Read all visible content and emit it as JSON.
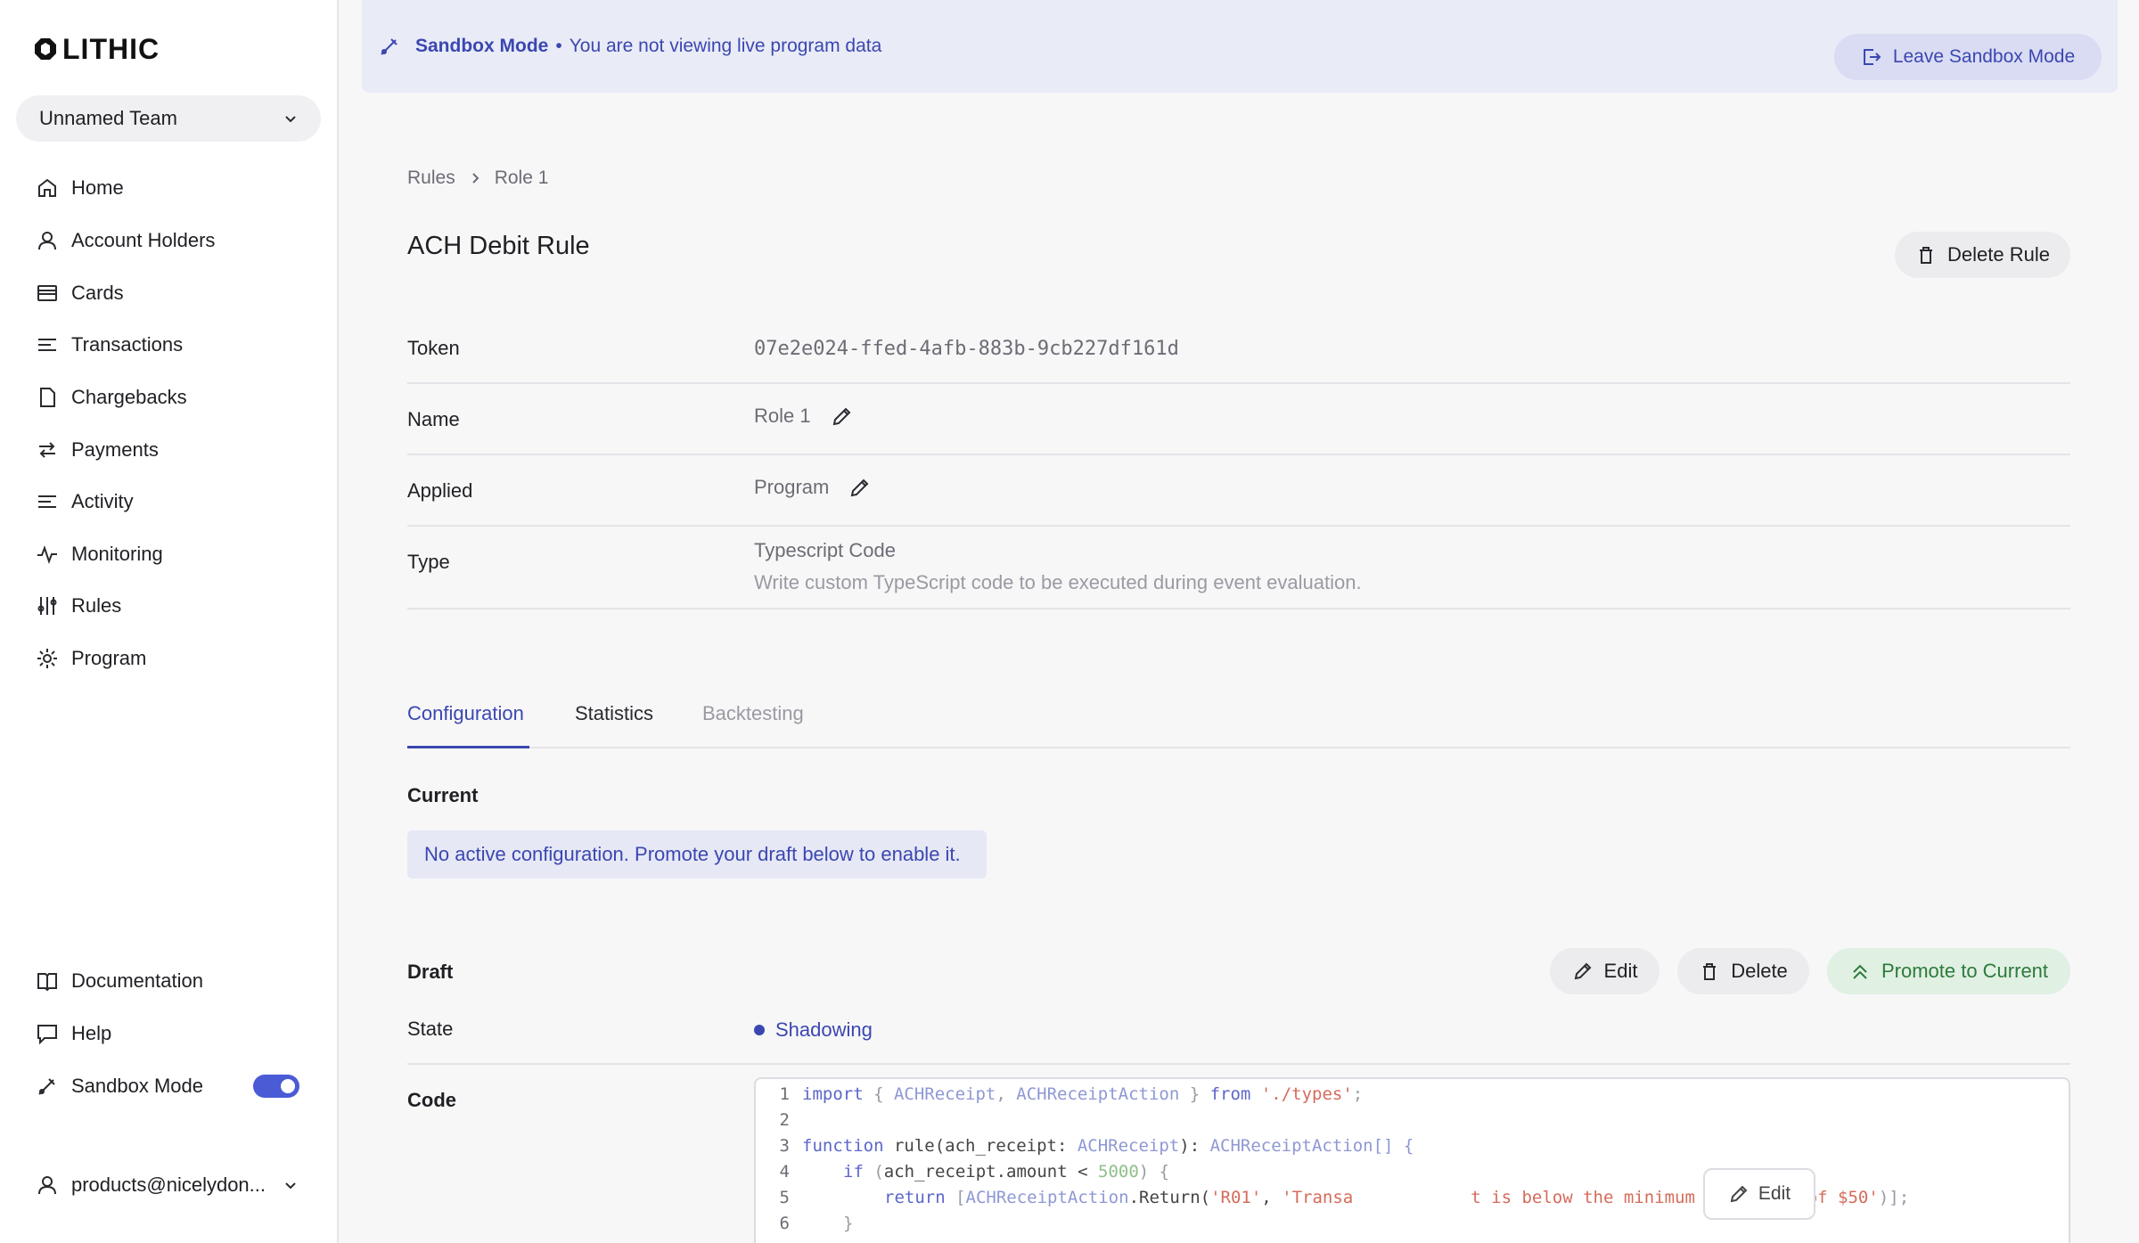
{
  "app": {
    "brand": "LITHIC"
  },
  "sidebar": {
    "team": "Unnamed Team",
    "items": [
      {
        "label": "Home",
        "icon": "home-icon"
      },
      {
        "label": "Account Holders",
        "icon": "user-icon"
      },
      {
        "label": "Cards",
        "icon": "card-icon"
      },
      {
        "label": "Transactions",
        "icon": "list-icon"
      },
      {
        "label": "Chargebacks",
        "icon": "file-icon"
      },
      {
        "label": "Payments",
        "icon": "arrows-icon"
      },
      {
        "label": "Activity",
        "icon": "list-icon"
      },
      {
        "label": "Monitoring",
        "icon": "pulse-icon"
      },
      {
        "label": "Rules",
        "icon": "sliders-icon"
      },
      {
        "label": "Program",
        "icon": "gear-icon"
      }
    ],
    "bottom": {
      "documentation": "Documentation",
      "help": "Help",
      "sandbox_mode": "Sandbox Mode",
      "sandbox_enabled": true,
      "user": "products@nicelydon..."
    }
  },
  "banner": {
    "title": "Sandbox Mode",
    "separator": "•",
    "message": "You are not viewing live program data",
    "leave_label": "Leave Sandbox Mode"
  },
  "breadcrumb": {
    "root": "Rules",
    "current": "Role 1"
  },
  "page": {
    "title": "ACH Debit Rule",
    "delete_label": "Delete Rule"
  },
  "details": {
    "token_label": "Token",
    "token_value": "07e2e024-ffed-4afb-883b-9cb227df161d",
    "name_label": "Name",
    "name_value": "Role 1",
    "applied_label": "Applied",
    "applied_value": "Program",
    "type_label": "Type",
    "type_value": "Typescript Code",
    "type_description": "Write custom TypeScript code to be executed during event evaluation."
  },
  "tabs": [
    {
      "label": "Configuration",
      "state": "active"
    },
    {
      "label": "Statistics",
      "state": "normal"
    },
    {
      "label": "Backtesting",
      "state": "disabled"
    }
  ],
  "config": {
    "current_label": "Current",
    "current_message": "No active configuration. Promote your draft below to enable it.",
    "draft_label": "Draft",
    "edit_label": "Edit",
    "delete_label": "Delete",
    "promote_label": "Promote to Current",
    "state_label": "State",
    "state_value": "Shadowing",
    "code_label": "Code",
    "code_edit_label": "Edit"
  },
  "code_lines": [
    "1",
    "2",
    "3",
    "4",
    "5",
    "6"
  ],
  "code_tokens": {
    "import": "import",
    "open_brace": " { ",
    "type_receipt": "ACHReceipt",
    "comma": ", ",
    "type_action": "ACHReceiptAction",
    "close_brace": " } ",
    "from": "from",
    "path": "'./types'",
    "semi": ";",
    "function": "function",
    "fn_sig": " rule(ach_receipt: ",
    "paren_close": "): ",
    "action_array": "ACHReceiptAction[] {",
    "if": "if",
    "cond_open": " (",
    "cond": "ach_receipt.amount < ",
    "amount": "5000",
    "cond_close": ") {",
    "return": "return",
    "ret_open": " [",
    "ret_type": "ACHReceiptAction",
    "dot_return": ".Return(",
    "code_r01": "'R01'",
    "msg_start": "'Transa",
    "msg_end": "t is below the minimum threshold of $50'",
    "ret_close": ")];",
    "brace": "}"
  },
  "colors": {
    "accent": "#3b47b0",
    "banner_bg": "#e9ebf7",
    "promote_bg": "#e0f0e3",
    "promote_text": "#2e7a3b"
  }
}
